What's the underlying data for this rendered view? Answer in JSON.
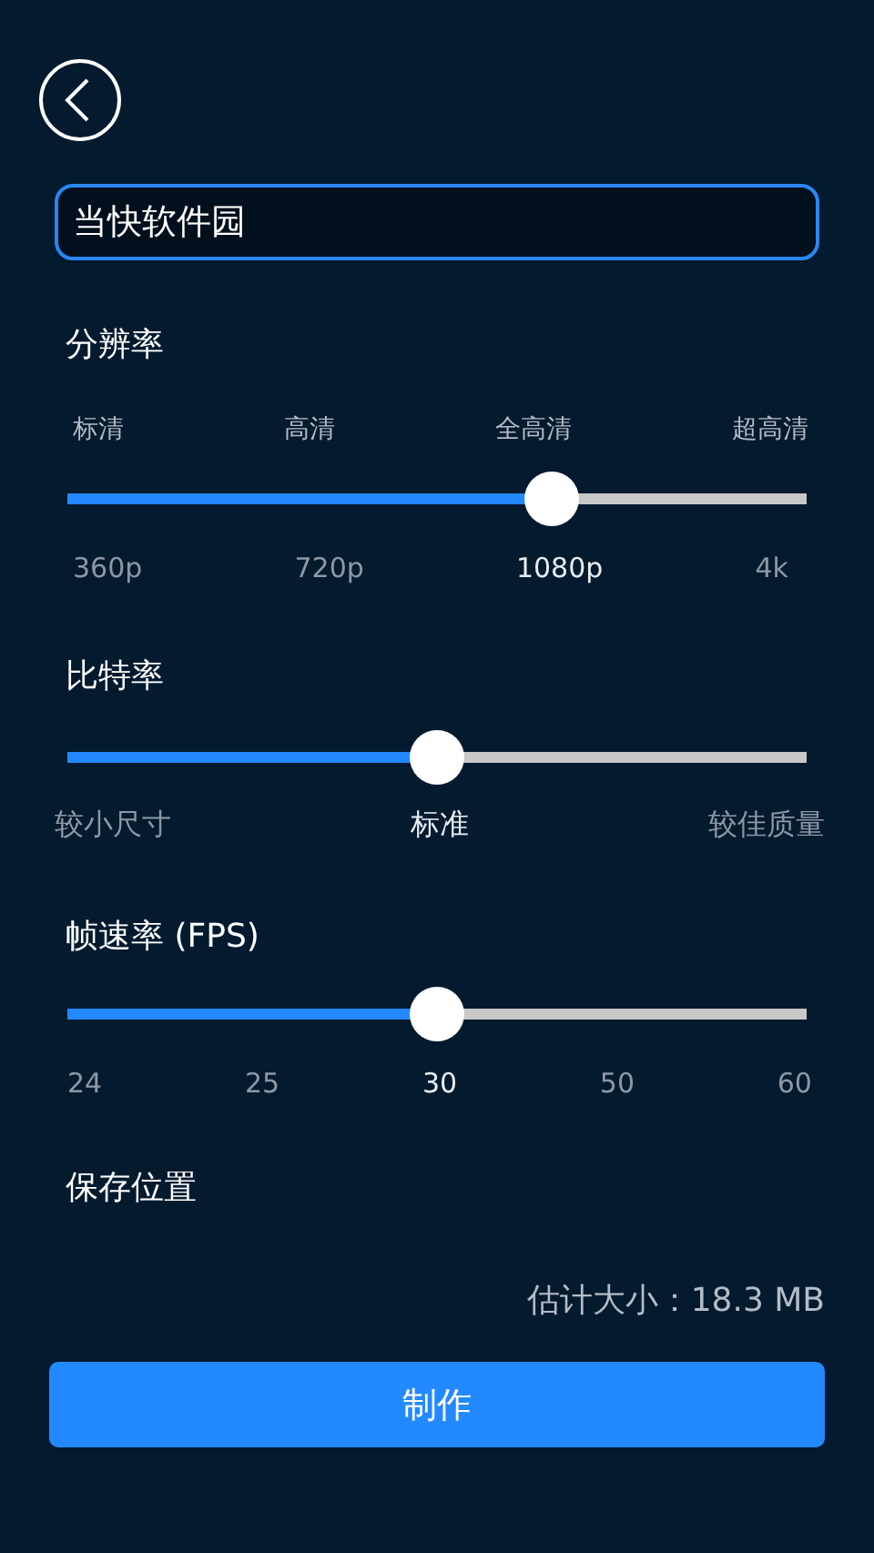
{
  "name_field": {
    "value": "当快软件园"
  },
  "sliders": [
    {
      "title": "分辨率",
      "top_labels": [
        "标清",
        "高清",
        "全高清",
        "超高清"
      ],
      "level": 0.655,
      "labels": [
        {
          "text": "360p",
          "selected": false
        },
        {
          "text": "720p",
          "selected": false
        },
        {
          "text": "1080p",
          "selected": true
        },
        {
          "text": "4k",
          "selected": false
        }
      ]
    },
    {
      "title": "比特率",
      "level": 0.5,
      "labels": [
        {
          "text": "较小尺寸",
          "selected": false
        },
        {
          "text": "标准",
          "selected": true
        },
        {
          "text": "较佳质量",
          "selected": false
        }
      ]
    },
    {
      "title": "帧速率 (FPS)",
      "level": 0.5,
      "labels": [
        {
          "text": "24",
          "selected": false
        },
        {
          "text": "25",
          "selected": false
        },
        {
          "text": "30",
          "selected": true
        },
        {
          "text": "50",
          "selected": false
        },
        {
          "text": "60",
          "selected": false
        }
      ]
    }
  ],
  "save_location": {
    "title": "保存位置"
  },
  "estimate": "估计大小：18.3 MB",
  "make_button": "制作"
}
